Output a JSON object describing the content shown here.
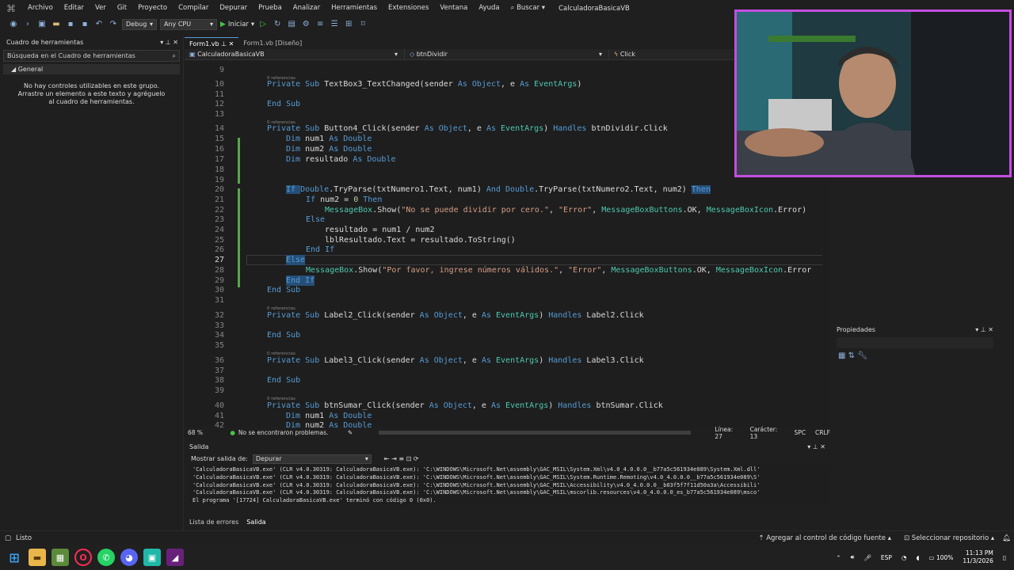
{
  "menubar": {
    "items": [
      "Archivo",
      "Editar",
      "Ver",
      "Git",
      "Proyecto",
      "Compilar",
      "Depurar",
      "Prueba",
      "Analizar",
      "Herramientas",
      "Extensiones",
      "Ventana",
      "Ayuda"
    ],
    "search_label": "Buscar",
    "app_title": "CalculadoraBasicaVB"
  },
  "toolbar": {
    "config": "Debug",
    "platform": "Any CPU",
    "run_label": "Iniciar"
  },
  "toolbox": {
    "title": "Cuadro de herramientas",
    "search_placeholder": "Búsqueda en el Cuadro de herramientas",
    "group": "General",
    "empty_message": "No hay controles utilizables en este grupo. Arrastre un elemento a este texto y agréguelo al cuadro de herramientas."
  },
  "editor": {
    "tabs": [
      {
        "label": "Form1.vb"
      },
      {
        "label": "Form1.vb [Diseño]"
      }
    ],
    "nav": {
      "project": "CalculadoraBasicaVB",
      "object": "btnDividir",
      "event": "Click"
    },
    "ref_label": "0 referencias",
    "lines": {
      "l10": {
        "p1": "Private Sub ",
        "p2": "TextBox3_TextChanged(sender ",
        "p3": "As ",
        "p4": "Object",
        "p5": ", e ",
        "p6": "As ",
        "p7": "EventArgs",
        "p8": ")"
      },
      "l12": "End Sub",
      "l14": {
        "p1": "Private Sub ",
        "p2": "Button4_Click(sender ",
        "p3": "As ",
        "p4": "Object",
        "p5": ", e ",
        "p6": "As ",
        "p7": "EventArgs",
        "p8": ") ",
        "p9": "Handles ",
        "p10": "btnDividir.Click"
      },
      "l15": {
        "p1": "Dim ",
        "p2": "num1 ",
        "p3": "As ",
        "p4": "Double"
      },
      "l16": {
        "p1": "Dim ",
        "p2": "num2 ",
        "p3": "As ",
        "p4": "Double"
      },
      "l17": {
        "p1": "Dim ",
        "p2": "resultado ",
        "p3": "As ",
        "p4": "Double"
      },
      "l20": {
        "p1": "If ",
        "p2": "Double",
        "p3": ".TryParse(txtNumero1.Text, num1) ",
        "p4": "And ",
        "p5": "Double",
        "p6": ".TryParse(txtNumero2.Text, num2) ",
        "p7": "Then"
      },
      "l21": {
        "p1": "If ",
        "p2": "num2 = ",
        "p3": "0",
        "p4": " Then"
      },
      "l22": {
        "p1": "MessageBox",
        "p2": ".Show(",
        "p3": "\"No se puede dividir por cero.\"",
        "p4": ", ",
        "p5": "\"Error\"",
        "p6": ", ",
        "p7": "MessageBoxButtons",
        "p8": ".OK, ",
        "p9": "MessageBoxIcon",
        "p10": ".Error)"
      },
      "l23": "Else",
      "l24": "resultado = num1 / num2",
      "l25": "lblResultado.Text = resultado.ToString()",
      "l26": "End If",
      "l27": "Else",
      "l28": {
        "p1": "MessageBox",
        "p2": ".Show(",
        "p3": "\"Por favor, ingrese números válidos.\"",
        "p4": ", ",
        "p5": "\"Error\"",
        "p6": ", ",
        "p7": "MessageBoxButtons",
        "p8": ".OK, ",
        "p9": "MessageBoxIcon",
        "p10": ".Error"
      },
      "l29": "End If",
      "l30": "End Sub",
      "l32": {
        "p1": "Private Sub ",
        "p2": "Label2_Click(sender ",
        "p3": "As ",
        "p4": "Object",
        "p5": ", e ",
        "p6": "As ",
        "p7": "EventArgs",
        "p8": ") ",
        "p9": "Handles ",
        "p10": "Label2.Click"
      },
      "l34": "End Sub",
      "l36": {
        "p1": "Private Sub ",
        "p2": "Label3_Click(sender ",
        "p3": "As ",
        "p4": "Object",
        "p5": ", e ",
        "p6": "As ",
        "p7": "EventArgs",
        "p8": ") ",
        "p9": "Handles ",
        "p10": "Label3.Click"
      },
      "l38": "End Sub",
      "l40": {
        "p1": "Private Sub ",
        "p2": "btnSumar_Click(sender ",
        "p3": "As ",
        "p4": "Object",
        "p5": ", e ",
        "p6": "As ",
        "p7": "EventArgs",
        "p8": ") ",
        "p9": "Handles ",
        "p10": "btnSumar.Click"
      },
      "l41": {
        "p1": "Dim ",
        "p2": "num1 ",
        "p3": "As ",
        "p4": "Double"
      },
      "l42": {
        "p1": "Dim ",
        "p2": "num2 ",
        "p3": "As ",
        "p4": "Double"
      }
    },
    "line_numbers": [
      "9",
      "10",
      "11",
      "12",
      "13",
      "14",
      "15",
      "16",
      "17",
      "18",
      "19",
      "20",
      "21",
      "22",
      "23",
      "24",
      "25",
      "26",
      "27",
      "28",
      "29",
      "30",
      "31",
      "32",
      "33",
      "34",
      "35",
      "36",
      "37",
      "38",
      "39",
      "40",
      "41",
      "42"
    ],
    "status": {
      "zoom": "68 %",
      "issues": "No se encontraron problemas.",
      "line": "Línea: 27",
      "char": "Carácter: 13",
      "spc": "SPC",
      "eol": "CRLF"
    }
  },
  "output": {
    "title": "Salida",
    "source_label": "Mostrar salida de:",
    "source_value": "Depurar",
    "lines": [
      "'CalculadoraBasicaVB.exe' (CLR v4.0.30319: CalculadoraBasicaVB.exe): 'C:\\WINDOWS\\Microsoft.Net\\assembly\\GAC_MSIL\\System.Xml\\v4.0_4.0.0.0__b77a5c561934e089\\System.Xml.dll'",
      "'CalculadoraBasicaVB.exe' (CLR v4.0.30319: CalculadoraBasicaVB.exe): 'C:\\WINDOWS\\Microsoft.Net\\assembly\\GAC_MSIL\\System.Runtime.Remoting\\v4.0_4.0.0.0__b77a5c561934e089\\S'",
      "'CalculadoraBasicaVB.exe' (CLR v4.0.30319: CalculadoraBasicaVB.exe): 'C:\\WINDOWS\\Microsoft.Net\\assembly\\GAC_MSIL\\Accessibility\\v4.0_4.0.0.0__b03f5f7f11d50a3a\\Accessibili'",
      "'CalculadoraBasicaVB.exe' (CLR v4.0.30319: CalculadoraBasicaVB.exe): 'C:\\WINDOWS\\Microsoft.Net\\assembly\\GAC_MSIL\\mscorlib.resources\\v4.0_4.0.0.0_es_b77a5c561934e089\\msco'",
      "El programa '[17724] CalculadoraBasicaVB.exe' terminó con código 0 (0x0)."
    ],
    "tabs": [
      "Lista de errores",
      "Salida"
    ]
  },
  "properties": {
    "title": "Propiedades"
  },
  "statusbar": {
    "ready": "Listo",
    "source_control": "Agregar al control de código fuente",
    "repo": "Seleccionar repositorio"
  },
  "tray": {
    "lang": "ESP",
    "battery": "100%",
    "time": "11:13 PM",
    "date": "11/3/2026"
  },
  "colors": {
    "accent": "#569cd6",
    "webcam_border": "#c44ee0",
    "git_bar": "#57a64a"
  }
}
